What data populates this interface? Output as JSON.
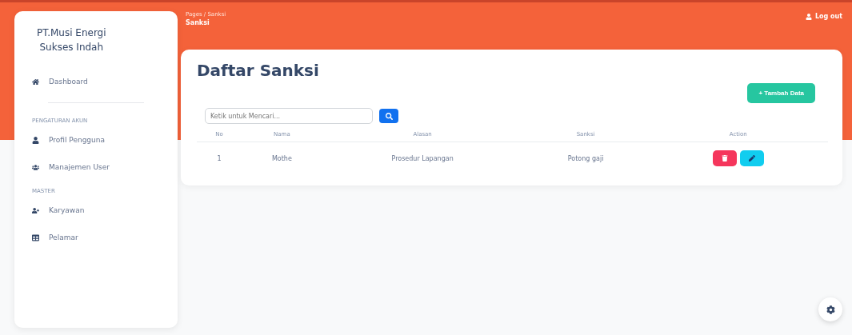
{
  "sidebar": {
    "brand": "PT.Musi Energi\nSukses Indah",
    "items": [
      {
        "kind": "link",
        "label": "Dashboard",
        "selected": false
      },
      {
        "kind": "divider"
      },
      {
        "kind": "heading",
        "label": "PENGATURAN AKUN"
      },
      {
        "kind": "link",
        "label": "Profil Pengguna",
        "selected": false
      },
      {
        "kind": "link",
        "label": "Manajemen User",
        "selected": false
      },
      {
        "kind": "heading",
        "label": "MASTER"
      },
      {
        "kind": "link",
        "label": "Karyawan",
        "selected": false
      },
      {
        "kind": "link",
        "label": "Pelamar",
        "selected": false
      }
    ]
  },
  "header": {
    "breadcrumb": "Pages / Sanksi",
    "title": "Sanksi",
    "logout": "Log out"
  },
  "card": {
    "title": "Daftar Sanksi",
    "add_button": "+ Tambah Data",
    "search": {
      "placeholder": "Ketik untuk Mencari..."
    },
    "table": {
      "columns": [
        "No",
        "Nama",
        "Alasan",
        "Sanksi",
        "Action"
      ],
      "rows": [
        {
          "cells": [
            "1",
            "Mothe",
            "Prosedur Lapangan",
            "Potong gaji"
          ]
        }
      ]
    }
  }
}
